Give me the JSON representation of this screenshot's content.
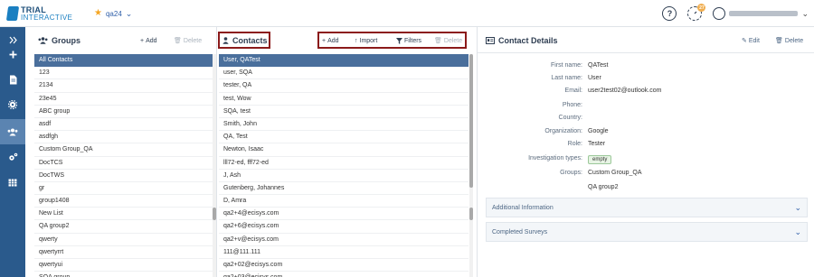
{
  "header": {
    "logo_line1": "TRIAL",
    "logo_line2": "INTERACTIVE",
    "project_name": "qa24",
    "help_icon": "?",
    "timer_badge": "27"
  },
  "nav": {
    "items": [
      {
        "icon": "expand-icon"
      },
      {
        "icon": "plus-icon"
      },
      {
        "icon": "document-icon"
      },
      {
        "icon": "gear-icon"
      },
      {
        "icon": "users-icon"
      },
      {
        "icon": "settings-icon"
      },
      {
        "icon": "table-icon"
      }
    ]
  },
  "groups": {
    "title": "Groups",
    "add_label": "Add",
    "delete_label": "Delete",
    "items": [
      "All Contacts",
      "123",
      "2134",
      "23e45",
      "ABC group",
      "asdf",
      "asdfgh",
      "Custom Group_QA",
      "DocTCS",
      "DocTWS",
      "gr",
      "group1408",
      "New List",
      "QA group2",
      "qwerty",
      "qwertyrrt",
      "qwertyui",
      "SQA group"
    ]
  },
  "contacts": {
    "title": "Contacts",
    "add_label": "Add",
    "import_label": "Import",
    "filters_label": "Filters",
    "delete_label": "Delete",
    "items": [
      "User, QATest",
      "user, SQA",
      "tester, QA",
      "test, Wow",
      "SQA, test",
      "Smith, John",
      "QA, Test",
      "Newton, Isaac",
      "lll72-ed, fff72-ed",
      "J, Ash",
      "Gutenberg, Johannes",
      "D, Amra",
      "qa2+4@ecisys.com",
      "qa2+6@ecisys.com",
      "qa2+v@ecisys.com",
      "111@111.111",
      "qa2+02@ecisys.com",
      "qa2+03@ecisys.com"
    ]
  },
  "details": {
    "title": "Contact Details",
    "edit_label": "Edit",
    "delete_label": "Delete",
    "fields": [
      {
        "label": "First name:",
        "value": "QATest"
      },
      {
        "label": "Last name:",
        "value": "User"
      },
      {
        "label": "Email:",
        "value": "user2test02@outlook.com"
      },
      {
        "label": "Phone:",
        "value": ""
      },
      {
        "label": "Country:",
        "value": ""
      },
      {
        "label": "Organization:",
        "value": "Google"
      },
      {
        "label": "Role:",
        "value": "Tester"
      },
      {
        "label": "Investigation types:",
        "value": "empty"
      },
      {
        "label": "Groups:",
        "value": "Custom Group_QA"
      },
      {
        "label": "",
        "value": "QA group2"
      }
    ],
    "accordion": [
      "Additional Information",
      "Completed Surveys"
    ]
  },
  "colors": {
    "rail": "#2a5a8c",
    "rail_active": "#5b84b1",
    "selected_row": "#4a6f9c",
    "highlight_box": "#8b1a1a",
    "star": "#f5a623"
  }
}
